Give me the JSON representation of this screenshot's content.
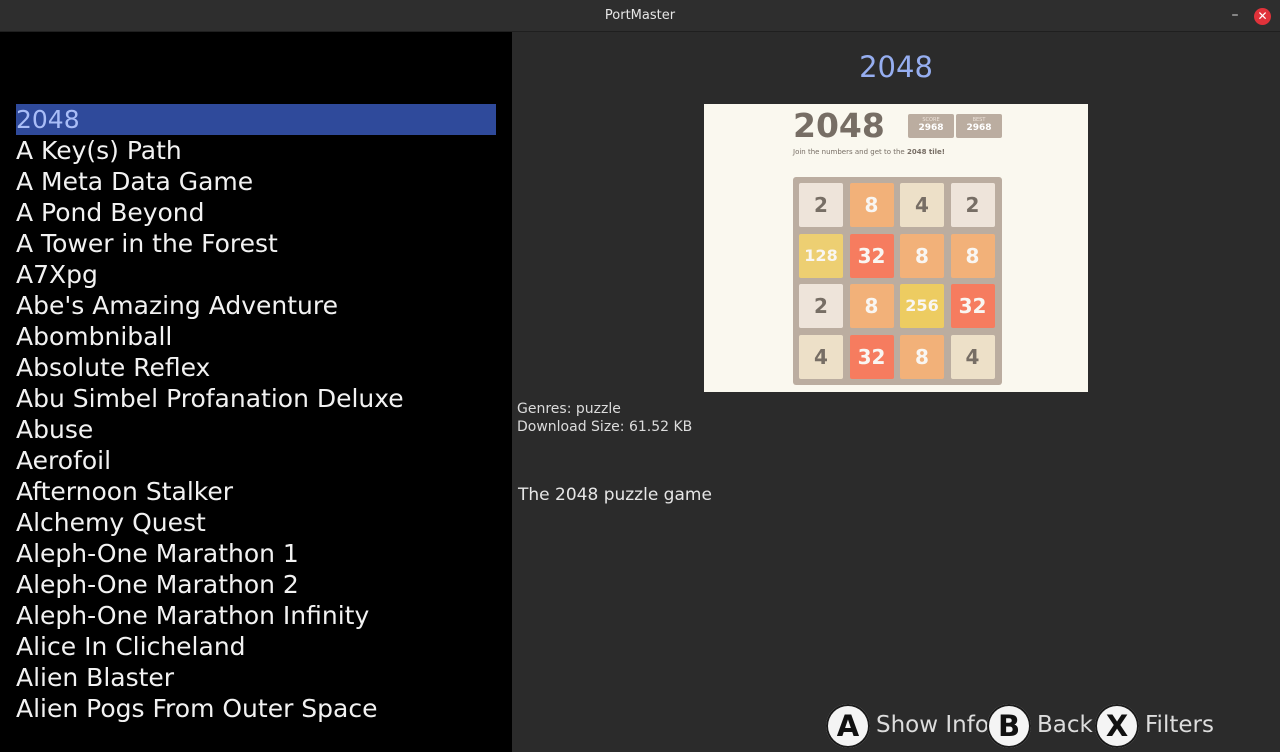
{
  "window": {
    "title": "PortMaster",
    "minimize_label": "–",
    "close_label": "✕"
  },
  "ports": [
    "2048",
    "A Key(s) Path",
    "A Meta Data Game",
    "A Pond Beyond",
    "A Tower in the Forest",
    "A7Xpg",
    "Abe's Amazing Adventure",
    "Abombniball",
    "Absolute Reflex",
    "Abu Simbel Profanation Deluxe",
    "Abuse",
    "Aerofoil",
    "Afternoon Stalker",
    "Alchemy Quest",
    "Aleph-One Marathon 1",
    "Aleph-One Marathon 2",
    "Aleph-One Marathon Infinity",
    "Alice In Clicheland",
    "Alien Blaster",
    "Alien Pogs From Outer Space"
  ],
  "selected_index": 0,
  "detail": {
    "title": "2048",
    "genres": "Genres: puzzle",
    "download_size": "Download Size: 61.52 KB",
    "description": "The 2048 puzzle game"
  },
  "screenshot": {
    "title": "2048",
    "score_label": "SCORE",
    "score_value": "2968",
    "best_label": "BEST",
    "best_value": "2968",
    "tagline_prefix": "Join the numbers and get to the ",
    "tagline_bold": "2048 tile!",
    "grid": [
      [
        "2",
        "8",
        "4",
        "2"
      ],
      [
        "128",
        "32",
        "8",
        "8"
      ],
      [
        "2",
        "8",
        "256",
        "32"
      ],
      [
        "4",
        "32",
        "8",
        "4"
      ]
    ]
  },
  "tile_colors": {
    "2": {
      "bg": "#eee4da",
      "fg": "#776e65"
    },
    "4": {
      "bg": "#ede0c8",
      "fg": "#776e65"
    },
    "8": {
      "bg": "#f2b179",
      "fg": "#f9f6f2"
    },
    "32": {
      "bg": "#f67c5f",
      "fg": "#f9f6f2"
    },
    "128": {
      "bg": "#edcf72",
      "fg": "#f9f6f2"
    },
    "256": {
      "bg": "#edcc61",
      "fg": "#f9f6f2"
    }
  },
  "actions": [
    {
      "key": "A",
      "label": "Show Info"
    },
    {
      "key": "B",
      "label": "Back"
    },
    {
      "key": "X",
      "label": "Filters"
    }
  ],
  "colors": {
    "selected_bg": "#2f4a9b",
    "selected_fg": "#a9bdf7",
    "title_accent": "#96aef0",
    "close_red": "#e0323a"
  }
}
